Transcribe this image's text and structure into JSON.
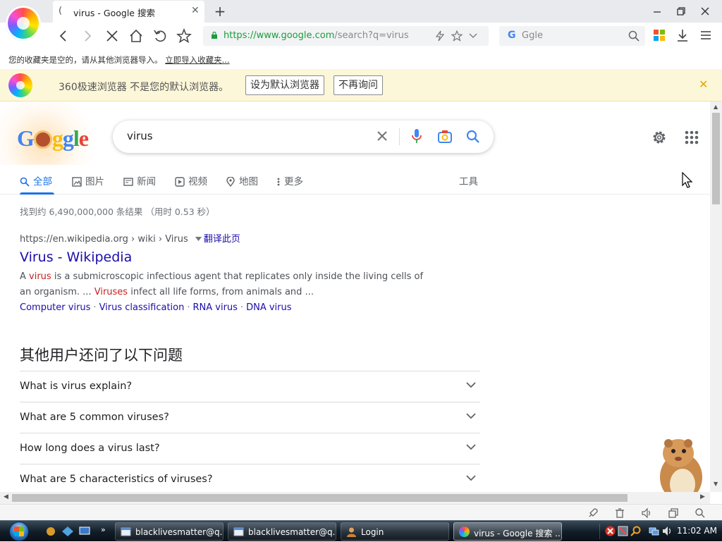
{
  "browser": {
    "tab_title": "virus - Google 搜索",
    "tab_loading_glyph": "(",
    "url_scheme": "https://",
    "url_host": "www.google.com",
    "url_rest": "/search?q=virus",
    "search_engine_placeholder": "Ggle",
    "search_engine_glyph": "G"
  },
  "bookmarks_bar": {
    "message": "您的收藏夹是空的，请从其他浏览器导入。",
    "import_link": "立即导入收藏夹..."
  },
  "notification": {
    "message": "360极速浏览器 不是您的默认浏览器。",
    "set_default_label": "设为默认浏览器",
    "dont_ask_label": "不再询问"
  },
  "google": {
    "logo_letters": [
      "G",
      "o",
      "g",
      "l",
      "e"
    ],
    "query": "virus",
    "tabs": [
      {
        "label": "全部",
        "icon": "search-icon"
      },
      {
        "label": "图片",
        "icon": "image-icon"
      },
      {
        "label": "新闻",
        "icon": "news-icon"
      },
      {
        "label": "视频",
        "icon": "play-icon"
      },
      {
        "label": "地图",
        "icon": "pin-icon"
      },
      {
        "label": "更多",
        "icon": "more-vert-icon"
      }
    ],
    "tools_label": "工具",
    "stats": "找到约 6,490,000,000 条结果 （用时 0.53 秒）",
    "result": {
      "cite_host": "https://en.wikipedia.org",
      "cite_path": " › wiki › Virus",
      "translate_label": "翻译此页",
      "title": "Virus - Wikipedia",
      "snippet_1a": "A ",
      "snippet_hl1": "virus",
      "snippet_1b": " is a submicroscopic infectious agent that replicates only inside the living cells of an organism. ... ",
      "snippet_hl2": "Viruses",
      "snippet_1c": " infect all life forms, from animals and ...",
      "sitelinks": [
        "Computer virus",
        "Virus classification",
        "RNA virus",
        "DNA virus"
      ]
    },
    "paa_title": "其他用户还问了以下问题",
    "paa": [
      "What is virus explain?",
      "What are 5 common viruses?",
      "How long does a virus last?",
      "What are 5 characteristics of viruses?"
    ]
  },
  "taskbar": {
    "buttons": [
      {
        "label": "blacklivesmatter@q...",
        "icon": "window-icon"
      },
      {
        "label": "blacklivesmatter@q...",
        "icon": "window-icon"
      },
      {
        "label": "Login",
        "icon": "user-icon"
      },
      {
        "label": "virus - Google 搜索 ...",
        "icon": "browser-icon"
      }
    ],
    "clock": "11:02 AM"
  },
  "colors": {
    "google_blue": "#4285f4",
    "link_blue": "#1a0dab",
    "active_tab_blue": "#1a73e8",
    "secure_green": "#1a9e3a",
    "notify_bg": "#fdf7d9"
  }
}
